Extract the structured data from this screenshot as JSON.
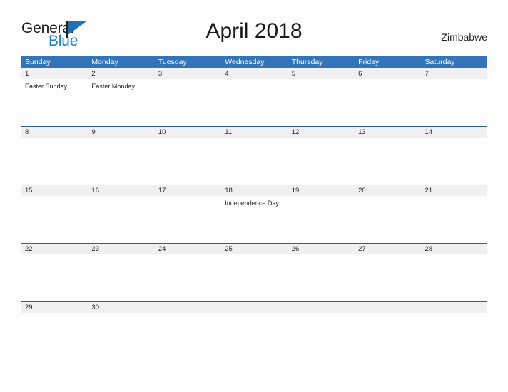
{
  "branding": {
    "word_general": "General",
    "word_blue": "Blue",
    "flag_icon": "flag-triangle-icon",
    "accent_color": "#1f7fd0"
  },
  "header": {
    "title": "April 2018",
    "country": "Zimbabwe"
  },
  "theme": {
    "header_blue": "#3374b8",
    "row_divider_blue": "#2a6099",
    "date_strip_gray": "#f0f0f0",
    "page_background": "#fdfdfd",
    "text_color": "#231f20"
  },
  "calendar": {
    "weekdays": [
      "Sunday",
      "Monday",
      "Tuesday",
      "Wednesday",
      "Thursday",
      "Friday",
      "Saturday"
    ],
    "weeks": [
      {
        "days": [
          {
            "date": "1",
            "event": "Easter Sunday"
          },
          {
            "date": "2",
            "event": "Easter Monday"
          },
          {
            "date": "3",
            "event": ""
          },
          {
            "date": "4",
            "event": ""
          },
          {
            "date": "5",
            "event": ""
          },
          {
            "date": "6",
            "event": ""
          },
          {
            "date": "7",
            "event": ""
          }
        ]
      },
      {
        "days": [
          {
            "date": "8",
            "event": ""
          },
          {
            "date": "9",
            "event": ""
          },
          {
            "date": "10",
            "event": ""
          },
          {
            "date": "11",
            "event": ""
          },
          {
            "date": "12",
            "event": ""
          },
          {
            "date": "13",
            "event": ""
          },
          {
            "date": "14",
            "event": ""
          }
        ]
      },
      {
        "days": [
          {
            "date": "15",
            "event": ""
          },
          {
            "date": "16",
            "event": ""
          },
          {
            "date": "17",
            "event": ""
          },
          {
            "date": "18",
            "event": "Independence Day"
          },
          {
            "date": "19",
            "event": ""
          },
          {
            "date": "20",
            "event": ""
          },
          {
            "date": "21",
            "event": ""
          }
        ]
      },
      {
        "days": [
          {
            "date": "22",
            "event": ""
          },
          {
            "date": "23",
            "event": ""
          },
          {
            "date": "24",
            "event": ""
          },
          {
            "date": "25",
            "event": ""
          },
          {
            "date": "26",
            "event": ""
          },
          {
            "date": "27",
            "event": ""
          },
          {
            "date": "28",
            "event": ""
          }
        ]
      },
      {
        "days": [
          {
            "date": "29",
            "event": ""
          },
          {
            "date": "30",
            "event": ""
          },
          {
            "date": "",
            "event": ""
          },
          {
            "date": "",
            "event": ""
          },
          {
            "date": "",
            "event": ""
          },
          {
            "date": "",
            "event": ""
          },
          {
            "date": "",
            "event": ""
          }
        ]
      }
    ]
  }
}
